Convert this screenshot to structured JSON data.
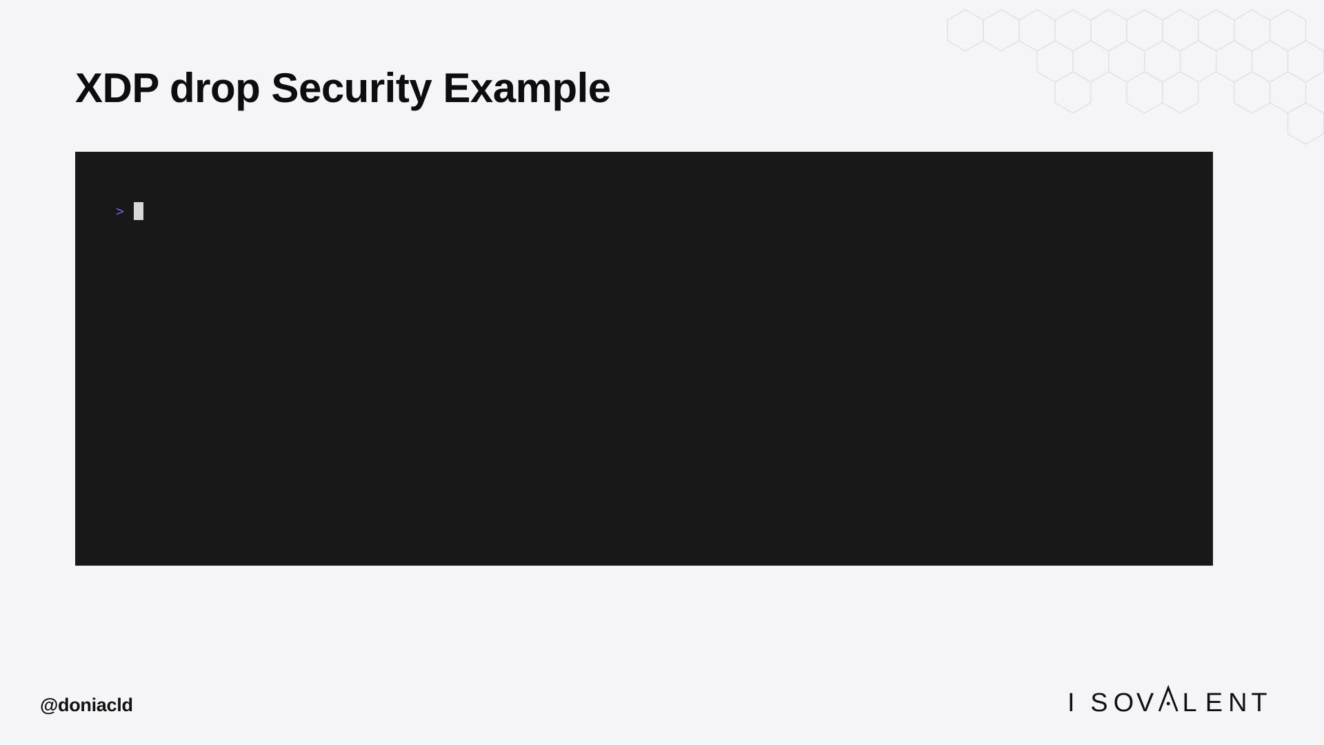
{
  "slide": {
    "title": "XDP drop Security Example",
    "author_handle": "@doniacld"
  },
  "terminal": {
    "prompt_symbol": ">",
    "input_text": "",
    "prompt_color": "#6a5fd6",
    "background_color": "#181818"
  },
  "brand": {
    "logo_text": "ISOVALENT",
    "logo_letters": [
      "I",
      "S",
      "O",
      "V",
      "A",
      "L",
      "E",
      "N",
      "T"
    ]
  },
  "icons": {
    "background_pattern": "hexagon-pattern-icon",
    "cursor": "block-cursor-icon"
  }
}
